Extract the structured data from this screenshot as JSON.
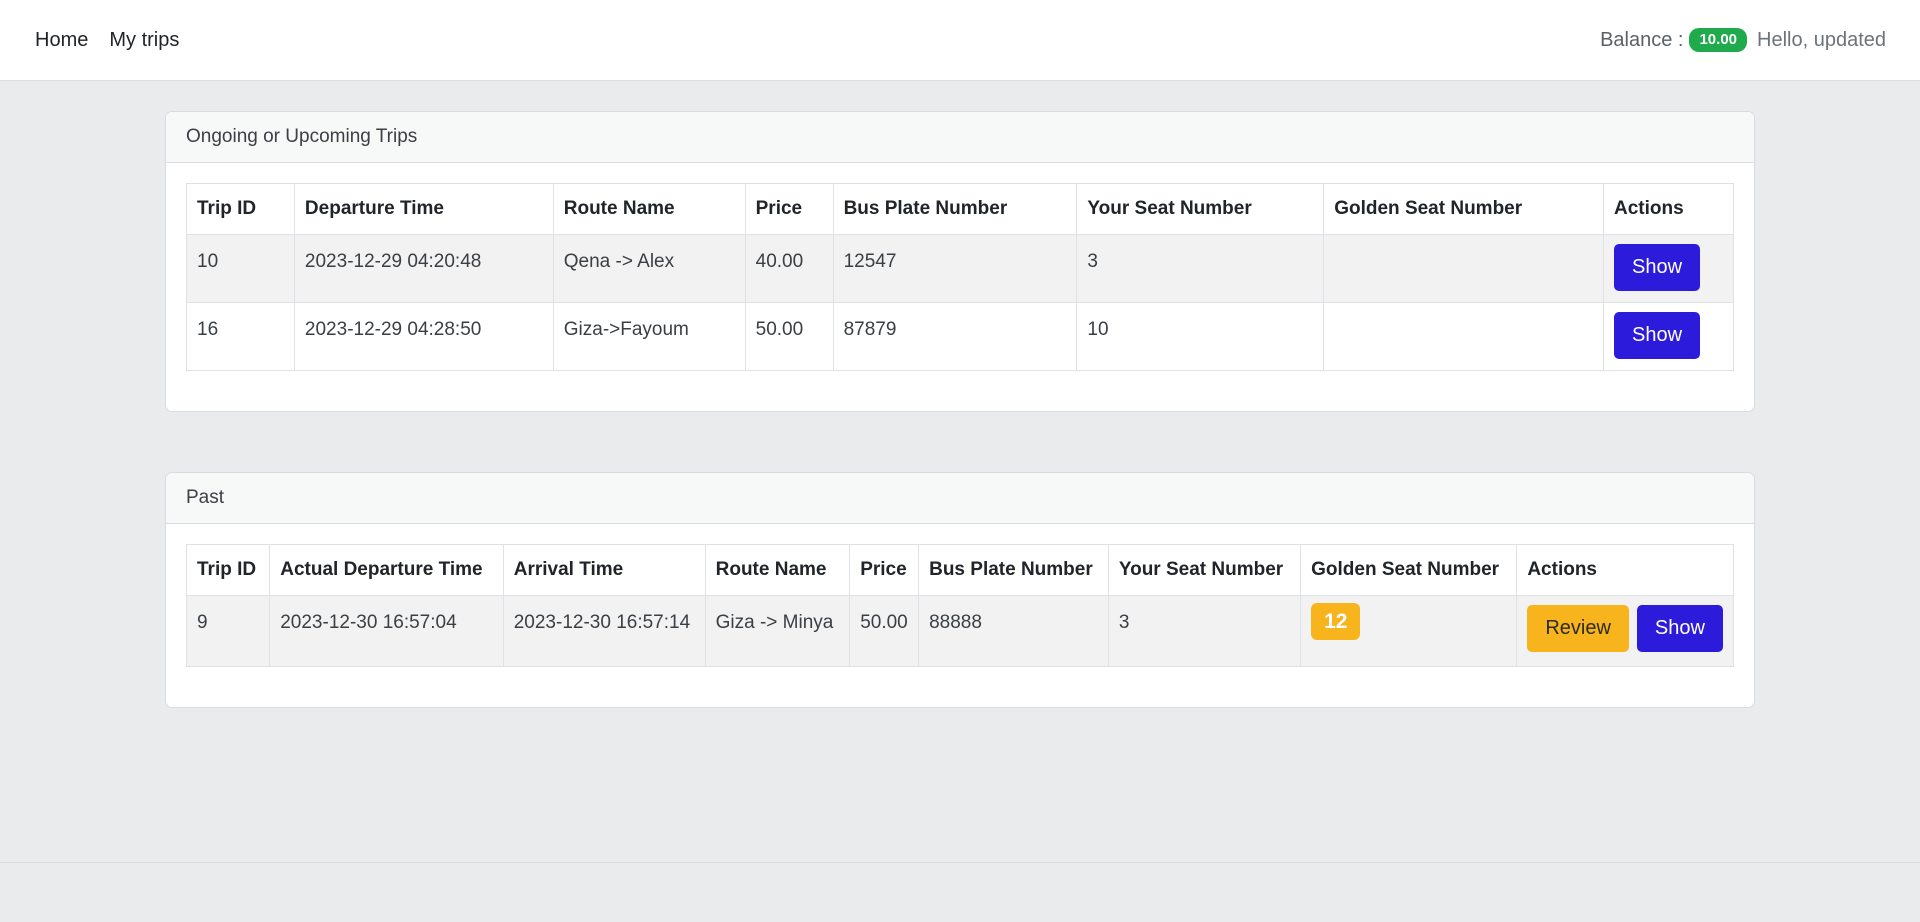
{
  "nav": {
    "links": [
      "Home",
      "My trips"
    ],
    "balance_label": "Balance :",
    "balance_value": "10.00",
    "greeting": "Hello, updated"
  },
  "upcoming": {
    "title": "Ongoing or Upcoming Trips",
    "columns": [
      "Trip ID",
      "Departure Time",
      "Route Name",
      "Price",
      "Bus Plate Number",
      "Your Seat Number",
      "Golden Seat Number",
      "Actions"
    ],
    "rows": [
      {
        "trip_id": "10",
        "departure": "2023-12-29 04:20:48",
        "route": "Qena -> Alex",
        "price": "40.00",
        "plate": "12547",
        "seat": "3",
        "golden": "",
        "action": "Show"
      },
      {
        "trip_id": "16",
        "departure": "2023-12-29 04:28:50",
        "route": "Giza->Fayoum",
        "price": "50.00",
        "plate": "87879",
        "seat": "10",
        "golden": "",
        "action": "Show"
      }
    ]
  },
  "past": {
    "title": "Past",
    "columns": [
      "Trip ID",
      "Actual Departure Time",
      "Arrival Time",
      "Route Name",
      "Price",
      "Bus Plate Number",
      "Your Seat Number",
      "Golden Seat Number",
      "Actions"
    ],
    "rows": [
      {
        "trip_id": "9",
        "departure": "2023-12-30 16:57:04",
        "arrival": "2023-12-30 16:57:14",
        "route": "Giza -> Minya",
        "price": "50.00",
        "plate": "88888",
        "seat": "3",
        "golden": "12",
        "review": "Review",
        "action": "Show"
      }
    ]
  },
  "colors": {
    "primary": "#2d1bdc",
    "warning": "#f7b41c",
    "success": "#1faa4b"
  }
}
